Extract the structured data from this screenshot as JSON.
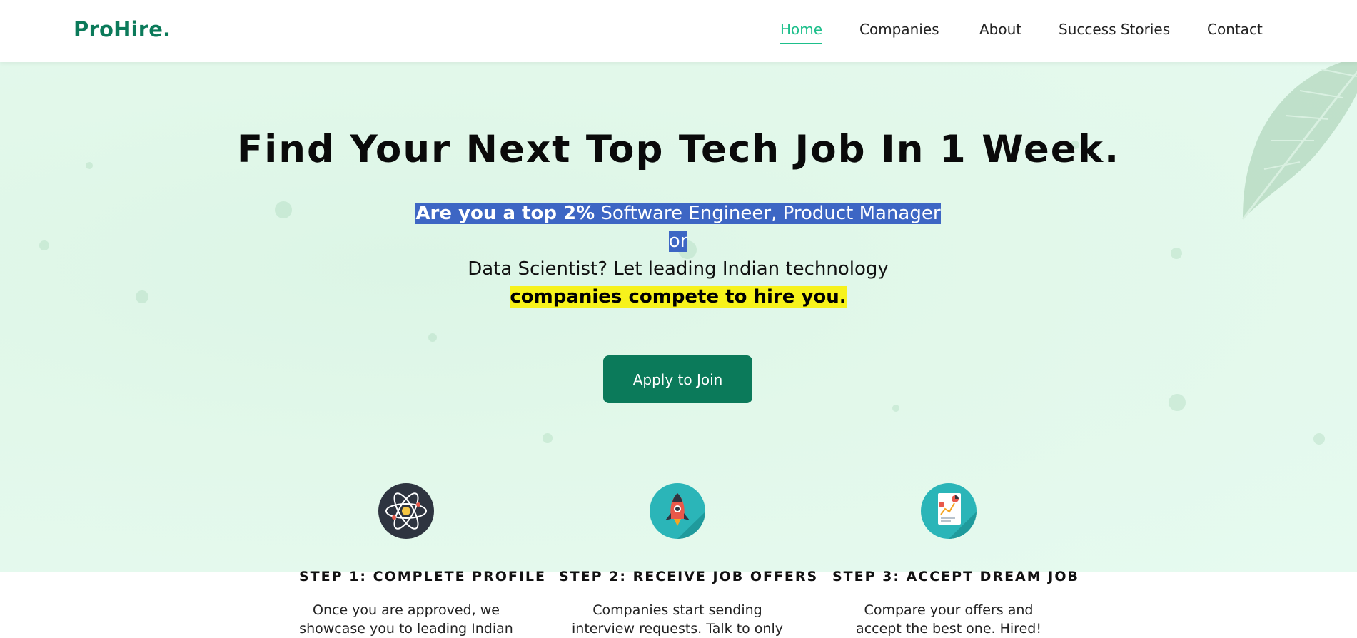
{
  "brand": {
    "logo": "ProHire."
  },
  "nav": {
    "items": [
      {
        "label": "Home",
        "active": true
      },
      {
        "label": "Companies",
        "active": false
      },
      {
        "label": "About",
        "active": false
      },
      {
        "label": "Success Stories",
        "active": false
      },
      {
        "label": "Contact",
        "active": false
      }
    ]
  },
  "hero": {
    "headline": "Find Your Next Top Tech Job In 1 Week.",
    "subtitle": {
      "part1_bold_selected": "Are you a top 2%",
      "part2_selected": " Software Engineer, Product Manager or",
      "part3_plain": "Data Scientist? Let leading Indian technology ",
      "part4_highlight": "companies compete to hire you."
    },
    "cta_label": "Apply to Join"
  },
  "steps": [
    {
      "icon": "atom-icon",
      "title": "STEP 1: COMPLETE PROFILE",
      "desc": "Once you are approved, we showcase you to leading Indian"
    },
    {
      "icon": "rocket-icon",
      "title": "STEP 2: RECEIVE JOB OFFERS",
      "desc": "Companies start sending interview requests. Talk to only"
    },
    {
      "icon": "report-chart-icon",
      "title": "STEP 3: ACCEPT DREAM JOB",
      "desc": "Compare your offers and accept the best one. Hired!"
    }
  ],
  "colors": {
    "brand": "#0b7a5a",
    "nav_active": "#1dbf8b",
    "hero_bg": "#e2f8ea",
    "selection": "#3d66c4",
    "highlight": "#f7f21c"
  }
}
